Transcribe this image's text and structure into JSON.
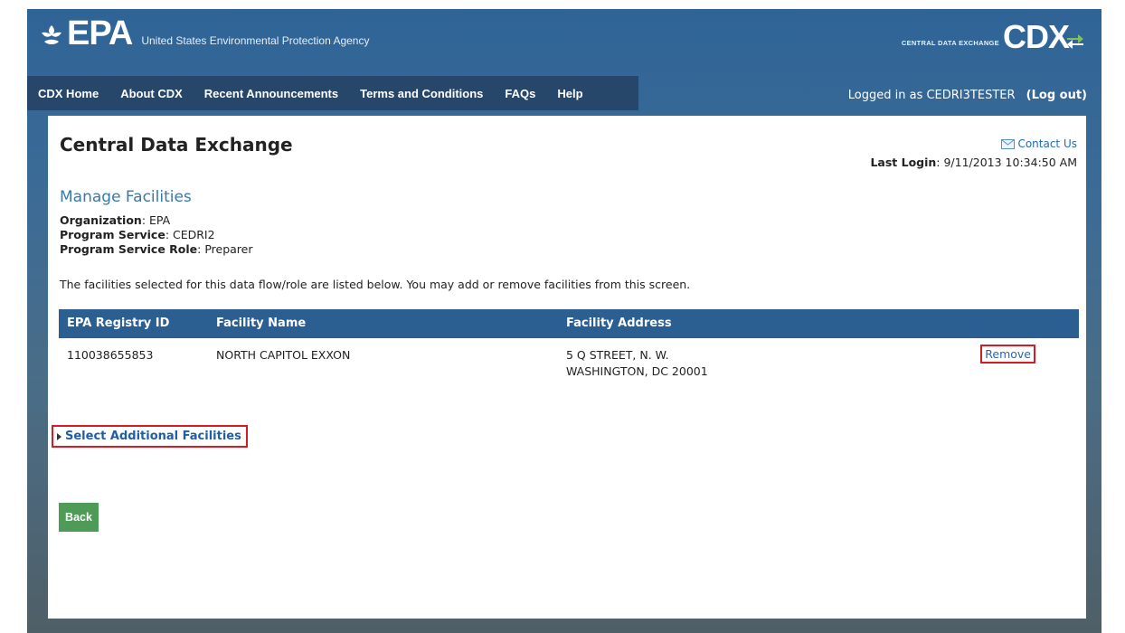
{
  "header": {
    "epa_logo": "EPA",
    "agency_name": "United States Environmental Protection Agency",
    "cdx_small": "CENTRAL DATA EXCHANGE",
    "cdx_big": "CDX"
  },
  "nav": {
    "items": [
      "CDX Home",
      "About CDX",
      "Recent Announcements",
      "Terms and Conditions",
      "FAQs",
      "Help"
    ]
  },
  "login": {
    "text": "Logged in as CEDRI3TESTER",
    "logout": "(Log out)"
  },
  "page": {
    "title": "Central Data Exchange",
    "contact": "Contact Us",
    "last_login_label": "Last Login",
    "last_login_value": ": 9/11/2013 10:34:50 AM",
    "section_title": "Manage Facilities",
    "org_label": "Organization",
    "org_value": ": EPA",
    "service_label": "Program Service",
    "service_value": ": CEDRI2",
    "role_label": "Program Service Role",
    "role_value": ": Preparer",
    "description": "The facilities selected for this data flow/role are listed below. You may add or remove facilities from this screen."
  },
  "table": {
    "headers": [
      "EPA Registry ID",
      "Facility Name",
      "Facility Address"
    ],
    "rows": [
      {
        "id": "110038655853",
        "name": "NORTH CAPITOL EXXON",
        "address1": "5 Q STREET, N. W.",
        "address2": "WASHINGTON, DC 20001",
        "action": "Remove"
      }
    ]
  },
  "actions": {
    "select_more": "Select Additional Facilities",
    "back": "Back"
  },
  "colors": {
    "nav_bg": "#27476a",
    "table_header": "#2b5e91",
    "highlight": "#d41c24",
    "back_button": "#4e9a57",
    "link": "#1f6bb0"
  }
}
